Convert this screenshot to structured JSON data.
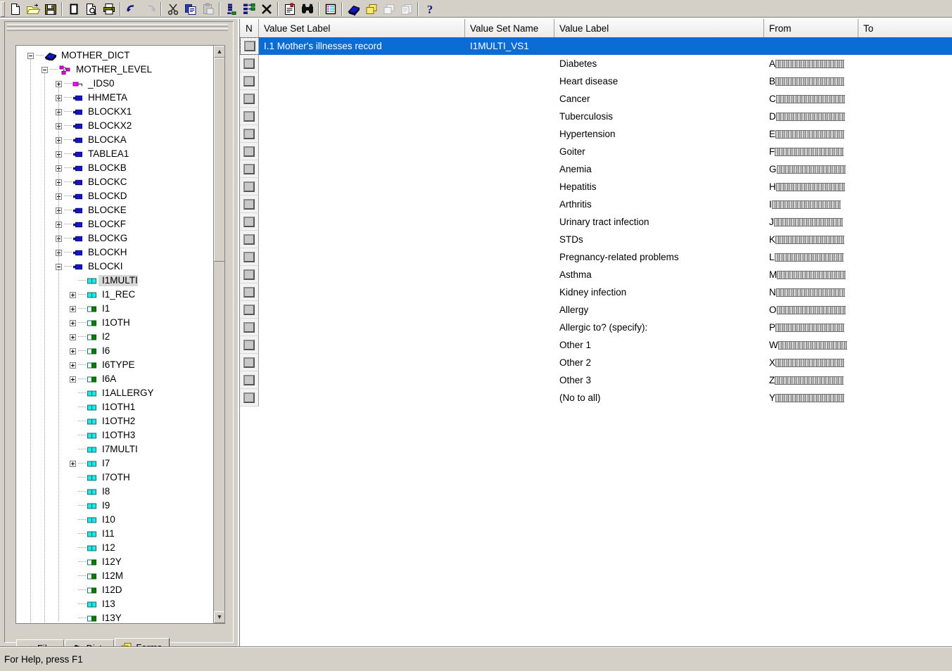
{
  "app": {
    "status_text": "For Help, press F1"
  },
  "toolbar": {
    "buttons": [
      {
        "name": "new-file-icon",
        "title": "New"
      },
      {
        "name": "open-folder-icon",
        "title": "Open"
      },
      {
        "name": "save-disk-icon",
        "title": "Save"
      },
      {
        "name": "page-icon",
        "title": "Page"
      },
      {
        "name": "print-preview-icon",
        "title": "Print Preview"
      },
      {
        "name": "printer-icon",
        "title": "Print"
      },
      {
        "name": "undo-arrow-icon",
        "title": "Undo"
      },
      {
        "name": "redo-arrow-icon",
        "title": "Redo"
      },
      {
        "name": "scissors-cut-icon",
        "title": "Cut"
      },
      {
        "name": "copy-pages-icon",
        "title": "Copy"
      },
      {
        "name": "clipboard-paste-icon",
        "title": "Paste"
      },
      {
        "name": "insert-item-icon",
        "title": "Insert"
      },
      {
        "name": "add-node-icon",
        "title": "Add"
      },
      {
        "name": "delete-x-icon",
        "title": "Delete"
      },
      {
        "name": "properties-card-icon",
        "title": "Properties"
      },
      {
        "name": "binoculars-find-icon",
        "title": "Find"
      },
      {
        "name": "value-set-table-icon",
        "title": "Value Sets"
      },
      {
        "name": "dictionary-book-icon",
        "title": "Dictionary"
      },
      {
        "name": "forms-stack-icon",
        "title": "Forms"
      },
      {
        "name": "forms-stack-disabled-icon",
        "title": "Forms (disabled)"
      },
      {
        "name": "pages-stack-disabled-icon",
        "title": "Pages (disabled)"
      },
      {
        "name": "help-question-icon",
        "title": "Help"
      }
    ]
  },
  "tree": {
    "nodes": [
      {
        "label": "MOTHER_DICT",
        "depth": 0,
        "toggle": "minus",
        "icon": "dict-book",
        "selected": false
      },
      {
        "label": "MOTHER_LEVEL",
        "depth": 1,
        "toggle": "minus",
        "icon": "level",
        "selected": false
      },
      {
        "label": "_IDS0",
        "depth": 2,
        "toggle": "plus",
        "icon": "record-pink",
        "selected": false
      },
      {
        "label": "HHMETA",
        "depth": 2,
        "toggle": "plus",
        "icon": "record-blue",
        "selected": false
      },
      {
        "label": "BLOCKX1",
        "depth": 2,
        "toggle": "plus",
        "icon": "record-blue",
        "selected": false
      },
      {
        "label": "BLOCKX2",
        "depth": 2,
        "toggle": "plus",
        "icon": "record-blue",
        "selected": false
      },
      {
        "label": "BLOCKA",
        "depth": 2,
        "toggle": "plus",
        "icon": "record-blue",
        "selected": false
      },
      {
        "label": "TABLEA1",
        "depth": 2,
        "toggle": "plus",
        "icon": "record-blue",
        "selected": false
      },
      {
        "label": "BLOCKB",
        "depth": 2,
        "toggle": "plus",
        "icon": "record-blue",
        "selected": false
      },
      {
        "label": "BLOCKC",
        "depth": 2,
        "toggle": "plus",
        "icon": "record-blue",
        "selected": false
      },
      {
        "label": "BLOCKD",
        "depth": 2,
        "toggle": "plus",
        "icon": "record-blue",
        "selected": false
      },
      {
        "label": "BLOCKE",
        "depth": 2,
        "toggle": "plus",
        "icon": "record-blue",
        "selected": false
      },
      {
        "label": "BLOCKF",
        "depth": 2,
        "toggle": "plus",
        "icon": "record-blue",
        "selected": false
      },
      {
        "label": "BLOCKG",
        "depth": 2,
        "toggle": "plus",
        "icon": "record-blue",
        "selected": false
      },
      {
        "label": "BLOCKH",
        "depth": 2,
        "toggle": "plus",
        "icon": "record-blue",
        "selected": false
      },
      {
        "label": "BLOCKI",
        "depth": 2,
        "toggle": "minus",
        "icon": "record-blue",
        "selected": false
      },
      {
        "label": "I1MULTI",
        "depth": 3,
        "toggle": "none",
        "icon": "item-cyan",
        "selected": true
      },
      {
        "label": "I1_REC",
        "depth": 3,
        "toggle": "plus",
        "icon": "item-cyan",
        "selected": false
      },
      {
        "label": "I1",
        "depth": 3,
        "toggle": "plus",
        "icon": "item-green",
        "selected": false
      },
      {
        "label": "I1OTH",
        "depth": 3,
        "toggle": "plus",
        "icon": "item-green",
        "selected": false
      },
      {
        "label": "I2",
        "depth": 3,
        "toggle": "plus",
        "icon": "item-green",
        "selected": false
      },
      {
        "label": "I6",
        "depth": 3,
        "toggle": "plus",
        "icon": "item-green",
        "selected": false
      },
      {
        "label": "I6TYPE",
        "depth": 3,
        "toggle": "plus",
        "icon": "item-green",
        "selected": false
      },
      {
        "label": "I6A",
        "depth": 3,
        "toggle": "plus",
        "icon": "item-green",
        "selected": false
      },
      {
        "label": "I1ALLERGY",
        "depth": 3,
        "toggle": "none",
        "icon": "item-cyan",
        "selected": false
      },
      {
        "label": "I1OTH1",
        "depth": 3,
        "toggle": "none",
        "icon": "item-cyan",
        "selected": false
      },
      {
        "label": "I1OTH2",
        "depth": 3,
        "toggle": "none",
        "icon": "item-cyan",
        "selected": false
      },
      {
        "label": "I1OTH3",
        "depth": 3,
        "toggle": "none",
        "icon": "item-cyan",
        "selected": false
      },
      {
        "label": "I7MULTI",
        "depth": 3,
        "toggle": "none",
        "icon": "item-cyan",
        "selected": false
      },
      {
        "label": "I7",
        "depth": 3,
        "toggle": "plus",
        "icon": "item-cyan",
        "selected": false
      },
      {
        "label": "I7OTH",
        "depth": 3,
        "toggle": "none",
        "icon": "item-cyan",
        "selected": false
      },
      {
        "label": "I8",
        "depth": 3,
        "toggle": "none",
        "icon": "item-cyan",
        "selected": false
      },
      {
        "label": "I9",
        "depth": 3,
        "toggle": "none",
        "icon": "item-cyan",
        "selected": false
      },
      {
        "label": "I10",
        "depth": 3,
        "toggle": "none",
        "icon": "item-cyan",
        "selected": false
      },
      {
        "label": "I11",
        "depth": 3,
        "toggle": "none",
        "icon": "item-cyan",
        "selected": false
      },
      {
        "label": "I12",
        "depth": 3,
        "toggle": "none",
        "icon": "item-cyan",
        "selected": false
      },
      {
        "label": "I12Y",
        "depth": 3,
        "toggle": "none",
        "icon": "item-green",
        "selected": false
      },
      {
        "label": "I12M",
        "depth": 3,
        "toggle": "none",
        "icon": "item-green",
        "selected": false
      },
      {
        "label": "I12D",
        "depth": 3,
        "toggle": "none",
        "icon": "item-green",
        "selected": false
      },
      {
        "label": "I13",
        "depth": 3,
        "toggle": "none",
        "icon": "item-cyan",
        "selected": false
      },
      {
        "label": "I13Y",
        "depth": 3,
        "toggle": "none",
        "icon": "item-green",
        "selected": false
      }
    ]
  },
  "panel_tabs": [
    {
      "label": "Files",
      "icon": "files-icon",
      "active": false
    },
    {
      "label": "Dicts",
      "icon": "dicts-book-icon",
      "active": false
    },
    {
      "label": "Forms",
      "icon": "forms-stack-icon",
      "active": true
    }
  ],
  "grid": {
    "columns": [
      {
        "key": "n",
        "label": "N"
      },
      {
        "key": "vsl",
        "label": "Value Set Label"
      },
      {
        "key": "vsn",
        "label": "Value Set Name"
      },
      {
        "key": "vl",
        "label": "Value Label"
      },
      {
        "key": "from",
        "label": "From"
      },
      {
        "key": "to",
        "label": "To"
      }
    ],
    "selection_color": "#0a6cd4",
    "rows": [
      {
        "vsl": "I.1 Mother's illnesses record",
        "vsn": "I1MULTI_VS1",
        "vl": "",
        "from": "",
        "to": "",
        "selected": true
      },
      {
        "vsl": "",
        "vsn": "",
        "vl": "Diabetes",
        "from": "A",
        "from_pad": true,
        "to": ""
      },
      {
        "vsl": "",
        "vsn": "",
        "vl": "Heart disease",
        "from": "B",
        "from_pad": true,
        "to": ""
      },
      {
        "vsl": "",
        "vsn": "",
        "vl": "Cancer",
        "from": "C",
        "from_pad": true,
        "to": ""
      },
      {
        "vsl": "",
        "vsn": "",
        "vl": "Tuberculosis",
        "from": "D",
        "from_pad": true,
        "to": ""
      },
      {
        "vsl": "",
        "vsn": "",
        "vl": "Hypertension",
        "from": "E",
        "from_pad": true,
        "to": ""
      },
      {
        "vsl": "",
        "vsn": "",
        "vl": "Goiter",
        "from": "F",
        "from_pad": true,
        "to": ""
      },
      {
        "vsl": "",
        "vsn": "",
        "vl": "Anemia",
        "from": "G",
        "from_pad": true,
        "to": ""
      },
      {
        "vsl": "",
        "vsn": "",
        "vl": "Hepatitis",
        "from": "H",
        "from_pad": true,
        "to": ""
      },
      {
        "vsl": "",
        "vsn": "",
        "vl": "Arthritis",
        "from": "I",
        "from_pad": true,
        "to": ""
      },
      {
        "vsl": "",
        "vsn": "",
        "vl": "Urinary tract infection",
        "from": "J",
        "from_pad": true,
        "to": ""
      },
      {
        "vsl": "",
        "vsn": "",
        "vl": "STDs",
        "from": "K",
        "from_pad": true,
        "to": ""
      },
      {
        "vsl": "",
        "vsn": "",
        "vl": "Pregnancy-related problems",
        "from": "L",
        "from_pad": true,
        "to": ""
      },
      {
        "vsl": "",
        "vsn": "",
        "vl": "Asthma",
        "from": "M",
        "from_pad": true,
        "to": ""
      },
      {
        "vsl": "",
        "vsn": "",
        "vl": "Kidney infection",
        "from": "N",
        "from_pad": true,
        "to": ""
      },
      {
        "vsl": "",
        "vsn": "",
        "vl": "Allergy",
        "from": "O",
        "from_pad": true,
        "to": ""
      },
      {
        "vsl": "",
        "vsn": "",
        "vl": "Allergic to? (specify):",
        "from": "P",
        "from_pad": true,
        "to": ""
      },
      {
        "vsl": "",
        "vsn": "",
        "vl": "Other 1",
        "from": "W",
        "from_pad": true,
        "to": ""
      },
      {
        "vsl": "",
        "vsn": "",
        "vl": "Other 2",
        "from": "X",
        "from_pad": true,
        "to": ""
      },
      {
        "vsl": "",
        "vsn": "",
        "vl": "Other 3",
        "from": "Z",
        "from_pad": true,
        "to": ""
      },
      {
        "vsl": "",
        "vsn": "",
        "vl": "(No to all)",
        "from": "Y",
        "from_pad": true,
        "to": ""
      }
    ]
  }
}
